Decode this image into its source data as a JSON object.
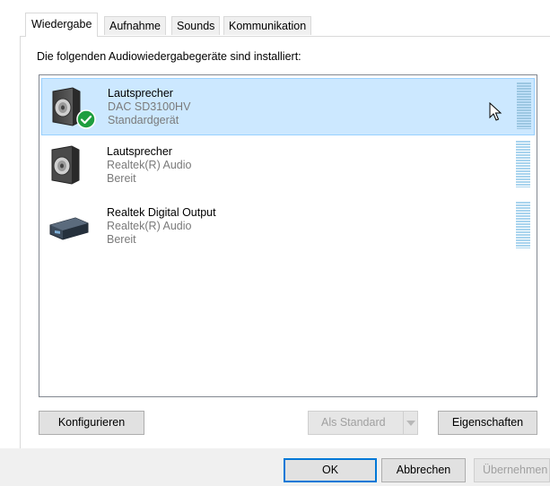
{
  "tabs": [
    {
      "label": "Wiedergabe",
      "active": true
    },
    {
      "label": "Aufnahme"
    },
    {
      "label": "Sounds"
    },
    {
      "label": "Kommunikation"
    }
  ],
  "instruction": "Die folgenden Audiowiedergabegeräte sind installiert:",
  "devices": [
    {
      "name": "Lautsprecher",
      "driver": "DAC SD3100HV",
      "status": "Standardgerät",
      "icon": "speaker-icon",
      "selected": true,
      "default": true
    },
    {
      "name": "Lautsprecher",
      "driver": "Realtek(R) Audio",
      "status": "Bereit",
      "icon": "speaker-icon"
    },
    {
      "name": "Realtek Digital Output",
      "driver": "Realtek(R) Audio",
      "status": "Bereit",
      "icon": "digital-output-icon"
    }
  ],
  "buttons": {
    "configure": "Konfigurieren",
    "set_default": "Als Standard",
    "properties": "Eigenschaften",
    "ok": "OK",
    "cancel": "Abbrechen",
    "apply": "Übernehmen"
  },
  "colors": {
    "selection_bg": "#cce8ff",
    "selection_border": "#99d1ff",
    "default_check": "#1e9e3f",
    "level_meter": "#a9d4ee"
  }
}
